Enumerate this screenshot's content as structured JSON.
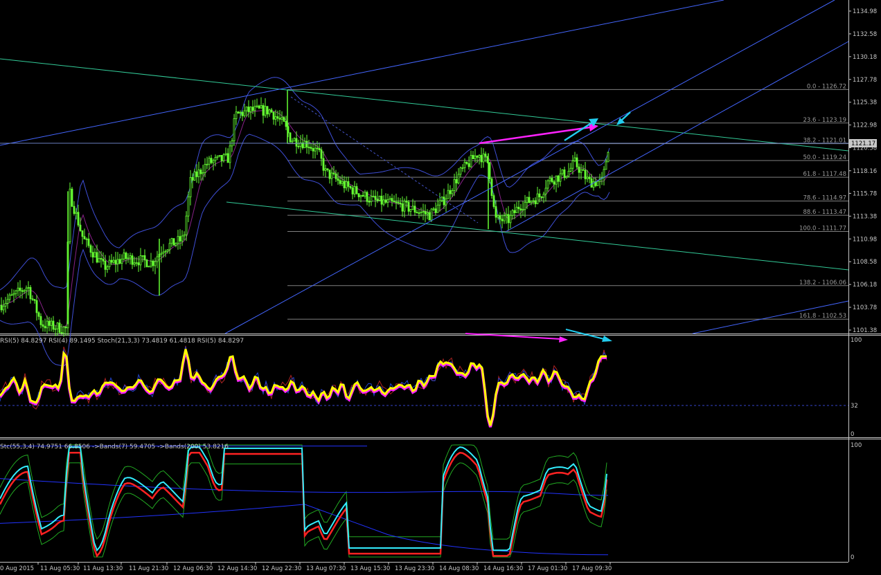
{
  "colors": {
    "background": "#000000",
    "candles": "#66ff33",
    "bollinger": "#3f4fd8",
    "channel_green": "#33cc99",
    "trendline_blue": "#4466ff",
    "fibo": "#808080",
    "divergence_magenta": "#ff22ff",
    "divergence_cyan": "#22ccee",
    "rsi_yellow": "#ffff00",
    "stoch_red": "#ff2222",
    "stoch_cyan": "#33eeff",
    "stoch_green": "#22aa22",
    "band_blue": "#2233ff"
  },
  "main": {
    "current_price": "1121.17",
    "price_ticks": [
      "1134.98",
      "1132.58",
      "1130.18",
      "1127.78",
      "1125.38",
      "1122.98",
      "1120.58",
      "1118.16",
      "1115.78",
      "1113.38",
      "1110.98",
      "1108.58",
      "1106.18",
      "1103.78",
      "1101.38"
    ],
    "fib_levels": [
      {
        "label": "0.0 - 1126.72",
        "price": 1126.72
      },
      {
        "label": "23.6 - 1123.19",
        "price": 1123.19
      },
      {
        "label": "38.2 - 1121.01",
        "price": 1121.01
      },
      {
        "label": "50.0 - 1119.24",
        "price": 1119.24
      },
      {
        "label": "61.8 - 1117.48",
        "price": 1117.48
      },
      {
        "label": "78.6 - 1114.97",
        "price": 1114.97
      },
      {
        "label": "88.6 - 1113.47",
        "price": 1113.47
      },
      {
        "label": "100.0 - 1111.77",
        "price": 1111.77
      },
      {
        "label": "138.2 - 1106.06",
        "price": 1106.06
      },
      {
        "label": "161.8 - 1102.53",
        "price": 1102.53
      }
    ]
  },
  "rsi_panel": {
    "header": "RSI(5) 84.8297  RSI(4) 89.1495  Stoch(21,3,3) 73.4819 61.4818  RSI(5) 84.8297",
    "ticks": [
      "100",
      "32",
      "0"
    ]
  },
  "stoch_panel": {
    "header": "Stc(55,3,4) 74.9751 66.8506  ->Bands(7) 59.4705  ->Bands(200) 53.8216",
    "ticks": [
      "100",
      "0"
    ]
  },
  "time_axis": [
    "0 Aug 2015",
    "11 Aug 05:30",
    "11 Aug 13:30",
    "11 Aug 21:30",
    "12 Aug 06:30",
    "12 Aug 14:30",
    "12 Aug 22:30",
    "13 Aug 07:30",
    "13 Aug 15:30",
    "13 Aug 23:30",
    "14 Aug 08:30",
    "14 Aug 16:30",
    "17 Aug 01:30",
    "17 Aug 09:30"
  ]
}
